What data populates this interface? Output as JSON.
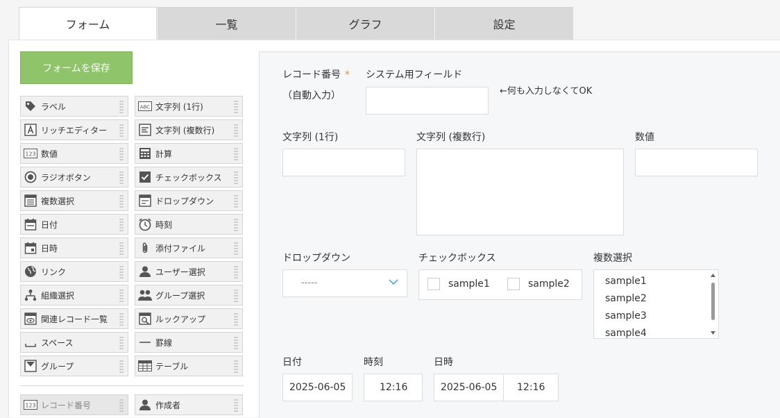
{
  "tabs": [
    {
      "label": "フォーム"
    },
    {
      "label": "一覧"
    },
    {
      "label": "グラフ"
    },
    {
      "label": "設定"
    }
  ],
  "palette": {
    "save_label": "フォームを保存",
    "items": [
      {
        "label": "ラベル",
        "icon": "tag-icon"
      },
      {
        "label": "文字列 (1行)",
        "icon": "abc-icon"
      },
      {
        "label": "リッチエディター",
        "icon": "rich-editor-icon"
      },
      {
        "label": "文字列 (複数行)",
        "icon": "multiline-text-icon"
      },
      {
        "label": "数値",
        "icon": "number-123-icon"
      },
      {
        "label": "計算",
        "icon": "calculator-icon"
      },
      {
        "label": "ラジオボタン",
        "icon": "radio-icon"
      },
      {
        "label": "チェックボックス",
        "icon": "checkbox-icon"
      },
      {
        "label": "複数選択",
        "icon": "multi-select-icon"
      },
      {
        "label": "ドロップダウン",
        "icon": "dropdown-icon"
      },
      {
        "label": "日付",
        "icon": "date-icon"
      },
      {
        "label": "時刻",
        "icon": "clock-icon"
      },
      {
        "label": "日時",
        "icon": "datetime-icon"
      },
      {
        "label": "添付ファイル",
        "icon": "paperclip-icon"
      },
      {
        "label": "リンク",
        "icon": "globe-icon"
      },
      {
        "label": "ユーザー選択",
        "icon": "user-icon"
      },
      {
        "label": "組織選択",
        "icon": "org-icon"
      },
      {
        "label": "グループ選択",
        "icon": "group-icon"
      },
      {
        "label": "関連レコード一覧",
        "icon": "related-records-icon"
      },
      {
        "label": "ルックアップ",
        "icon": "lookup-icon"
      },
      {
        "label": "スペース",
        "icon": "space-icon"
      },
      {
        "label": "罫線",
        "icon": "line-icon"
      },
      {
        "label": "グループ",
        "icon": "group-box-icon"
      },
      {
        "label": "テーブル",
        "icon": "table-icon"
      }
    ],
    "system_items": [
      {
        "label": "レコード番号",
        "icon": "number-123-icon"
      },
      {
        "label": "作成者",
        "icon": "user-icon"
      }
    ]
  },
  "form": {
    "record_number_label": "レコード番号",
    "required_mark": "*",
    "auto_input": "（自動入力）",
    "system_field_label": "システム用フィールド",
    "system_field_value": "",
    "note": "←何も入力しなくてOK",
    "text1_label": "文字列 (1行)",
    "text1_value": "",
    "textm_label": "文字列 (複数行)",
    "textm_value": "",
    "number_label": "数値",
    "number_value": "",
    "dropdown_label": "ドロップダウン",
    "dropdown_value": "-----",
    "checkbox_label": "チェックボックス",
    "checkbox_options": [
      "sample1",
      "sample2"
    ],
    "multi_label": "複数選択",
    "multi_options": [
      "sample1",
      "sample2",
      "sample3",
      "sample4"
    ],
    "date_label": "日付",
    "date_value": "2025-06-05",
    "time_label": "時刻",
    "time_value": "12:16",
    "datetime_label": "日時",
    "datetime_date": "2025-06-05",
    "datetime_time": "12:16"
  }
}
